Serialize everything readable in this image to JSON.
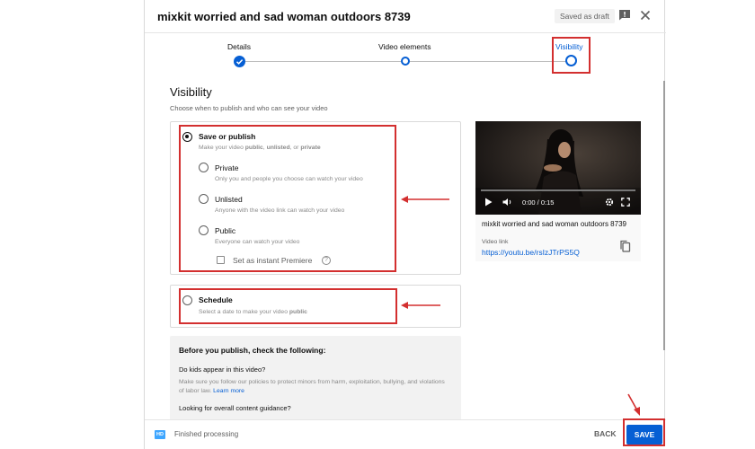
{
  "header": {
    "title": "mixkit worried and sad woman outdoors 8739",
    "draft_status": "Saved as draft"
  },
  "steps": [
    {
      "label": "Details",
      "state": "complete"
    },
    {
      "label": "Video elements",
      "state": "pending"
    },
    {
      "label": "Visibility",
      "state": "current"
    }
  ],
  "visibility": {
    "heading": "Visibility",
    "subheading": "Choose when to publish and who can see your video",
    "save_publish": {
      "title": "Save or publish",
      "desc_prefix": "Make your video ",
      "desc_public": "public",
      "desc_sep1": ", ",
      "desc_unlisted": "unlisted",
      "desc_sep2": ", or ",
      "desc_private": "private",
      "options": [
        {
          "title": "Private",
          "desc": "Only you and people you choose can watch your video"
        },
        {
          "title": "Unlisted",
          "desc": "Anyone with the video link can watch your video"
        },
        {
          "title": "Public",
          "desc": "Everyone can watch your video"
        }
      ],
      "premiere_label": "Set as instant Premiere",
      "premiere_help": "?"
    },
    "schedule": {
      "title": "Schedule",
      "desc_prefix": "Select a date to make your video ",
      "desc_bold": "public"
    }
  },
  "video": {
    "time": "0:00 / 0:15",
    "title": "mixkit worried and sad woman outdoors 8739",
    "link_label": "Video link",
    "link": "https://youtu.be/rsIzJTrPS5Q",
    "progress": 0.0
  },
  "checklist": {
    "title": "Before you publish, check the following:",
    "q1": "Do kids appear in this video?",
    "q1_text": "Make sure you follow our policies to protect minors from harm, exploitation, bullying, and violations of labor law.",
    "q1_link": "Learn more",
    "q2": "Looking for overall content guidance?"
  },
  "footer": {
    "hd_badge": "HD",
    "status": "Finished processing",
    "back_label": "BACK",
    "save_label": "SAVE"
  },
  "colors": {
    "accent": "#065fd4",
    "highlight": "#d32f2f"
  }
}
